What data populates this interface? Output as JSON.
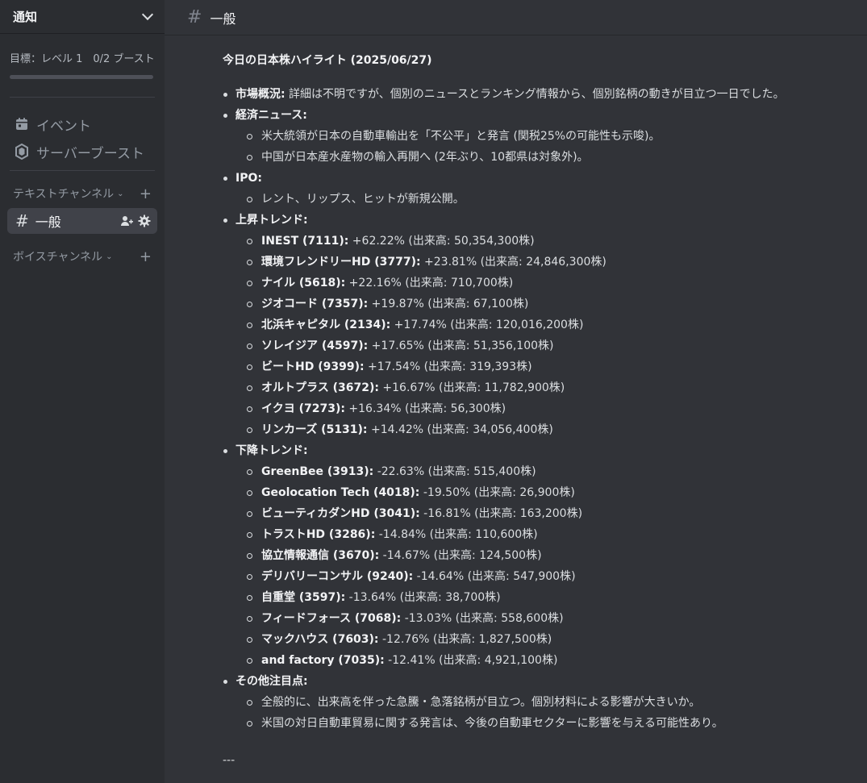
{
  "sidebar": {
    "server_name": "通知",
    "boost_goal": "目標：レベル 1　0/2 ブースト",
    "boost_progress": 0,
    "nav": [
      {
        "label": "イベント",
        "icon": "calendar-icon"
      },
      {
        "label": "サーバーブースト",
        "icon": "boost-gem-icon"
      }
    ],
    "text_category": "テキストチャンネル",
    "voice_category": "ボイスチャンネル",
    "active_channel": "一般"
  },
  "topbar": {
    "channel_name": "一般"
  },
  "message": {
    "title": "今日の日本株ハイライト (2025/06/27)",
    "sections": [
      {
        "label": "市場概況:",
        "text": " 詳細は不明ですが、個別のニュースとランキング情報から、個別銘柄の動きが目立つ一日でした。",
        "items": []
      },
      {
        "label": "経済ニュース:",
        "text": "",
        "items": [
          {
            "text": "米大統領が日本の自動車輸出を「不公平」と発言 (関税25%の可能性も示唆)。"
          },
          {
            "text": "中国が日本産水産物の輸入再開へ (2年ぶり、10都県は対象外)。"
          }
        ]
      },
      {
        "label": "IPO:",
        "text": "",
        "items": [
          {
            "text": "レント、リップス、ヒットが新規公開。"
          }
        ]
      },
      {
        "label": "上昇トレンド:",
        "text": "",
        "items": [
          {
            "bold": "INEST (7111):",
            "text": " +62.22% (出来高: 50,354,300株)"
          },
          {
            "bold": "環境フレンドリーHD (3777):",
            "text": " +23.81% (出来高: 24,846,300株)"
          },
          {
            "bold": "ナイル (5618):",
            "text": " +22.16% (出来高: 710,700株)"
          },
          {
            "bold": "ジオコード (7357):",
            "text": " +19.87% (出来高: 67,100株)"
          },
          {
            "bold": "北浜キャピタル (2134):",
            "text": " +17.74% (出来高: 120,016,200株)"
          },
          {
            "bold": "ソレイジア (4597):",
            "text": " +17.65% (出来高: 51,356,100株)"
          },
          {
            "bold": "ビートHD (9399):",
            "text": " +17.54% (出来高: 319,393株)"
          },
          {
            "bold": "オルトプラス (3672):",
            "text": " +16.67% (出来高: 11,782,900株)"
          },
          {
            "bold": "イクヨ (7273):",
            "text": " +16.34% (出来高: 56,300株)"
          },
          {
            "bold": "リンカーズ (5131):",
            "text": " +14.42% (出来高: 34,056,400株)"
          }
        ]
      },
      {
        "label": "下降トレンド:",
        "text": "",
        "items": [
          {
            "bold": "GreenBee (3913):",
            "text": " -22.63% (出来高: 515,400株)"
          },
          {
            "bold": "Geolocation Tech (4018):",
            "text": " -19.50% (出来高: 26,900株)"
          },
          {
            "bold": "ビューティカダンHD (3041):",
            "text": " -16.81% (出来高: 163,200株)"
          },
          {
            "bold": "トラストHD (3286):",
            "text": " -14.84% (出来高: 110,600株)"
          },
          {
            "bold": "協立情報通信 (3670):",
            "text": " -14.67% (出来高: 124,500株)"
          },
          {
            "bold": "デリバリーコンサル (9240):",
            "text": " -14.64% (出来高: 547,900株)"
          },
          {
            "bold": "自重堂 (3597):",
            "text": " -13.64% (出来高: 38,700株)"
          },
          {
            "bold": "フィードフォース (7068):",
            "text": " -13.03% (出来高: 558,600株)"
          },
          {
            "bold": "マックハウス (7603):",
            "text": " -12.76% (出来高: 1,827,500株)"
          },
          {
            "bold": "and factory (7035):",
            "text": " -12.41% (出来高: 4,921,100株)"
          }
        ]
      },
      {
        "label": "その他注目点:",
        "text": "",
        "items": [
          {
            "text": "全般的に、出来高を伴った急騰・急落銘柄が目立つ。個別材料による影響が大きいか。"
          },
          {
            "text": "米国の対日自動車貿易に関する発言は、今後の自動車セクターに影響を与える可能性あり。"
          }
        ]
      }
    ],
    "footer": "---"
  }
}
